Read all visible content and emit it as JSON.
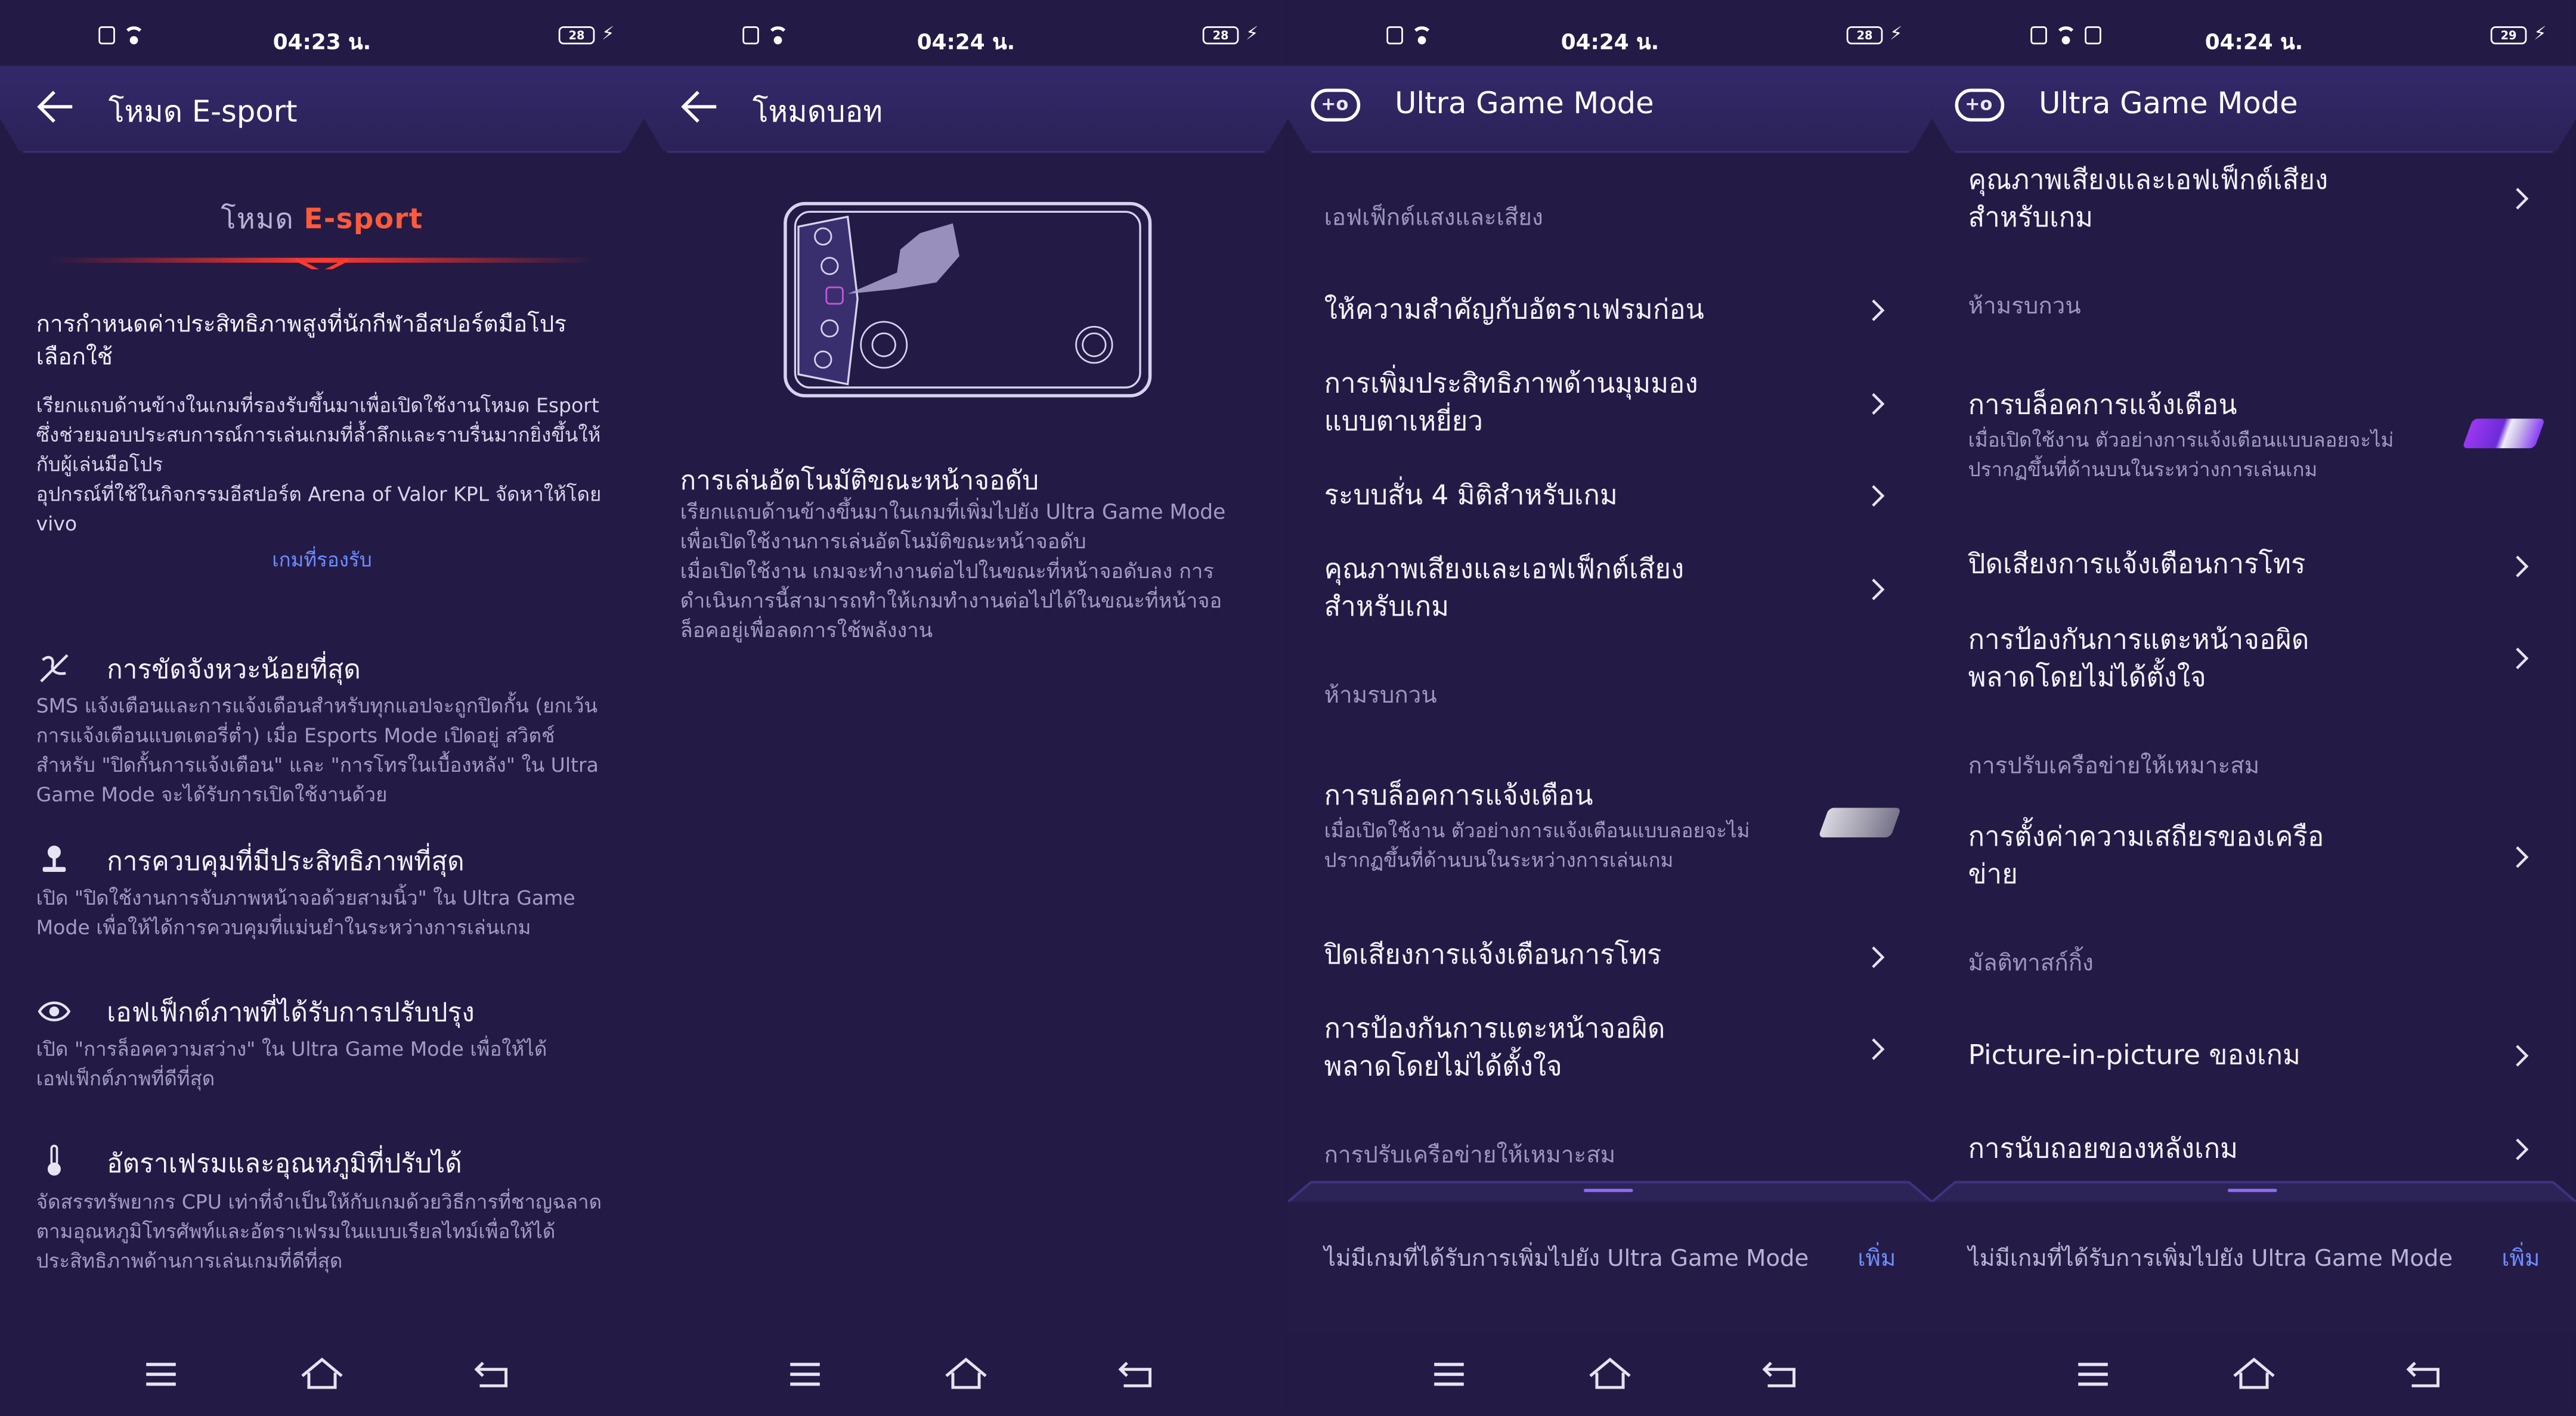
{
  "status": {
    "screen1_time": "04:23 น.",
    "screen2_time": "04:24 น.",
    "screen3_time": "04:24 น.",
    "screen4_time": "04:24 น.",
    "battery_1": "28",
    "battery_2": "28",
    "battery_3": "28",
    "battery_4": "29"
  },
  "screen1": {
    "title": "โหมด E-sport",
    "logo_prefix": "โหมด ",
    "logo_brand": "E-sport",
    "headline": "การกำหนดค่าประสิทธิภาพสูงที่นักกีฬาอีสปอร์ตมืออาชีพเลือกใช้",
    "headline_line1": "การกำหนดค่าประสิทธิภาพสูงที่นักกีฬาอีสปอร์ตมือโปร",
    "headline_line2": "เลือกใช้",
    "desc1": "เรียกแถบด้านข้างในเกมที่รองรับขึ้นมาเพื่อเปิดใช้งานโหมด Esport ซึ่งช่วยมอบประสบการณ์การเล่นเกมที่ล้ำลึกและราบรื่นมากยิ่งขึ้นให้กับผู้เล่นมือโปร",
    "desc2": "อุปกรณ์ที่ใช้ในกิจกรรมอีสปอร์ต Arena of Valor KPL จัดหาให้โดย vivo",
    "supported_link": "เกมที่รองรับ",
    "features": [
      {
        "title": "การขัดจังหวะน้อยที่สุด",
        "desc": "SMS แจ้งเตือนและการแจ้งเตือนสำหรับทุกแอปจะถูกปิดกั้น (ยกเว้นการแจ้งเตือนแบตเตอรี่ต่ำ) เมื่อ Esports Mode เปิดอยู่ สวิตช์สำหรับ \"ปิดกั้นการแจ้งเตือน\" และ \"การโทรในเบื้องหลัง\" ใน Ultra Game Mode จะได้รับการเปิดใช้งานด้วย",
        "icon": "no-disturb-icon"
      },
      {
        "title": "การควบคุมที่มีประสิทธิภาพที่สุด",
        "desc": "เปิด \"ปิดใช้งานการจับภาพหน้าจอด้วยสามนิ้ว\" ใน Ultra Game Mode เพื่อให้ได้การควบคุมที่แม่นยำในระหว่างการเล่นเกม",
        "icon": "joystick-icon"
      },
      {
        "title": "เอฟเฟ็กต์ภาพที่ได้รับการปรับปรุง",
        "desc": "เปิด \"การล็อคความสว่าง\" ใน Ultra Game Mode เพื่อให้ได้เอฟเฟ็กต์ภาพที่ดีที่สุด",
        "icon": "eye-icon"
      },
      {
        "title": "อัตราเฟรมและอุณหภูมิที่ปรับได้",
        "desc": "จัดสรรทรัพยากร CPU เท่าที่จำเป็นให้กับเกมด้วยวิธีการที่ชาญฉลาดตามอุณหภูมิโทรศัพท์และอัตราเฟรมในแบบเรียลไทม์เพื่อให้ได้ประสิทธิภาพด้านการเล่นเกมที่ดีที่สุด",
        "icon": "thermometer-icon"
      }
    ]
  },
  "screen2": {
    "title": "โหมดบอท",
    "section_title": "การเล่นอัตโนมัติขณะหน้าจอดับ",
    "desc1": "เรียกแถบด้านข้างขึ้นมาในเกมที่เพิ่มไปยัง Ultra Game Mode เพื่อเปิดใช้งานการเล่นอัตโนมัติขณะหน้าจอดับ",
    "desc2": "เมื่อเปิดใช้งาน เกมจะทำงานต่อไปในขณะที่หน้าจอดับลง การดำเนินการนี้สามารถทำให้เกมทำงานต่อไปได้ในขณะที่หน้าจอล็อคอยู่เพื่อลดการใช้พลังงาน"
  },
  "screen3": {
    "title": "Ultra Game Mode",
    "section_effects": "เอฟเฟ็กต์แสงและเสียง",
    "items": [
      "ให้ความสำคัญกับอัตราเฟรมก่อน",
      "การเพิ่มประสิทธิภาพด้านมุมมองแบบตาเหยี่ยว",
      "ระบบสั่น 4 มิติสำหรับเกม",
      "คุณภาพเสียงและเอฟเฟ็กต์เสียงสำหรับเกม"
    ],
    "section_dnd": "ห้ามรบกวน",
    "block_notif": "การบล็อคการแจ้งเตือน",
    "block_notif_sub": "เมื่อเปิดใช้งาน ตัวอย่างการแจ้งเตือนแบบลอยจะไม่ปรากฏขึ้นที่ด้านบนในระหว่างการเล่นเกม",
    "block_notif_on": false,
    "mute_call": "ปิดเสียงการแจ้งเตือนการโทร",
    "prevent_touch": "การป้องกันการแตะหน้าจอผิดพลาดโดยไม่ได้ตั้งใจ",
    "section_network": "การปรับเครือข่ายให้เหมาะสม",
    "no_games": "ไม่มีเกมที่ได้รับการเพิ่มไปยัง Ultra Game Mode",
    "add": "เพิ่ม"
  },
  "screen4": {
    "title": "Ultra Game Mode",
    "audio": "คุณภาพเสียงและเอฟเฟ็กต์เสียงสำหรับเกม",
    "section_dnd": "ห้ามรบกวน",
    "block_notif": "การบล็อคการแจ้งเตือน",
    "block_notif_sub": "เมื่อเปิดใช้งาน ตัวอย่างการแจ้งเตือนแบบลอยจะไม่ปรากฏขึ้นที่ด้านบนในระหว่างการเล่นเกม",
    "block_notif_on": true,
    "mute_call": "ปิดเสียงการแจ้งเตือนการโทร",
    "prevent_touch": "การป้องกันการแตะหน้าจอผิดพลาดโดยไม่ได้ตั้งใจ",
    "section_network": "การปรับเครือข่ายให้เหมาะสม",
    "network_stability": "การตั้งค่าความเสถียรของเครือข่าย",
    "section_multitask": "มัลติทาสก์กิ้ง",
    "pip": "Picture-in-picture ของเกม",
    "countdown": "การนับถอยของหลังเกม",
    "no_games": "ไม่มีเกมที่ได้รับการเพิ่มไปยัง Ultra Game Mode",
    "add": "เพิ่ม"
  },
  "colors": {
    "background": "#231b45",
    "header": "#33296a",
    "accent_link": "#6f8dff",
    "esport_orange": "#ff5a3a"
  }
}
